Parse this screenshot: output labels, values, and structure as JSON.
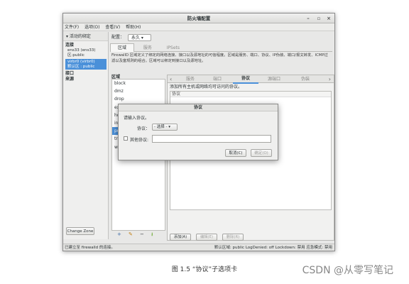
{
  "window": {
    "title": "防火墙配置",
    "minimize": "–",
    "maximize": "▫",
    "close": "×"
  },
  "menu": [
    "文件(F)",
    "选项(O)",
    "查看(V)",
    "帮助(H)"
  ],
  "left": {
    "active_bindings": "▾ 活动的绑定",
    "connections_header": "连接",
    "conn1_name": "ens33 (ens33)",
    "conn1_zone": "区:public",
    "conn2_name": "virbr0 (virbr0)",
    "conn2_zone": "默认区 : public",
    "interfaces_header": "接口",
    "sources_header": "来源",
    "change_zone": "Change Zone"
  },
  "config": {
    "label": "配置：",
    "value": "永久"
  },
  "main_tabs": [
    "区域",
    "服务",
    "IPSets"
  ],
  "description": "FirewallD 区域定义了绑定的网络连接、接口以及源地址的可信程度。区域是服务、端口、协议、IP伪装、端口/报文转发、ICMP过滤以及富规则的组合。区域可以绑定到接口以及源地址。",
  "zones": {
    "header": "区域",
    "items": [
      "block",
      "dmz",
      "drop",
      "ex",
      "ho",
      "int",
      "pu",
      "tr",
      "w"
    ],
    "selected": 6,
    "add_icon": "+",
    "edit_icon": "✎",
    "remove_icon": "−",
    "load_icon": "⭳"
  },
  "subtabs": [
    "服务",
    "端口",
    "协议",
    "源端口",
    "伪装"
  ],
  "subtab_active": 2,
  "subpanel": {
    "description": "添加所有主机或网络均可访问的协议。",
    "list_header": "协议",
    "add": "添加(A)",
    "edit": "编辑(E)",
    "remove": "删除(R)"
  },
  "dialog": {
    "title": "协议",
    "prompt": "请输入协议。",
    "protocol_label": "协议：",
    "protocol_value": "- 选择 - ▾",
    "other_label": "其他协议:",
    "other_value": "",
    "cancel": "取消(C)",
    "ok": "确定(O)"
  },
  "status": {
    "left": "已建立至 firewalld 的连接。",
    "right": "默认区域: public  LogDenied: off  Lockdown: 禁用  应急模式: 禁用"
  },
  "caption": "图 1.5 “协议”子选项卡",
  "watermark": "CSDN @从零写笔记"
}
